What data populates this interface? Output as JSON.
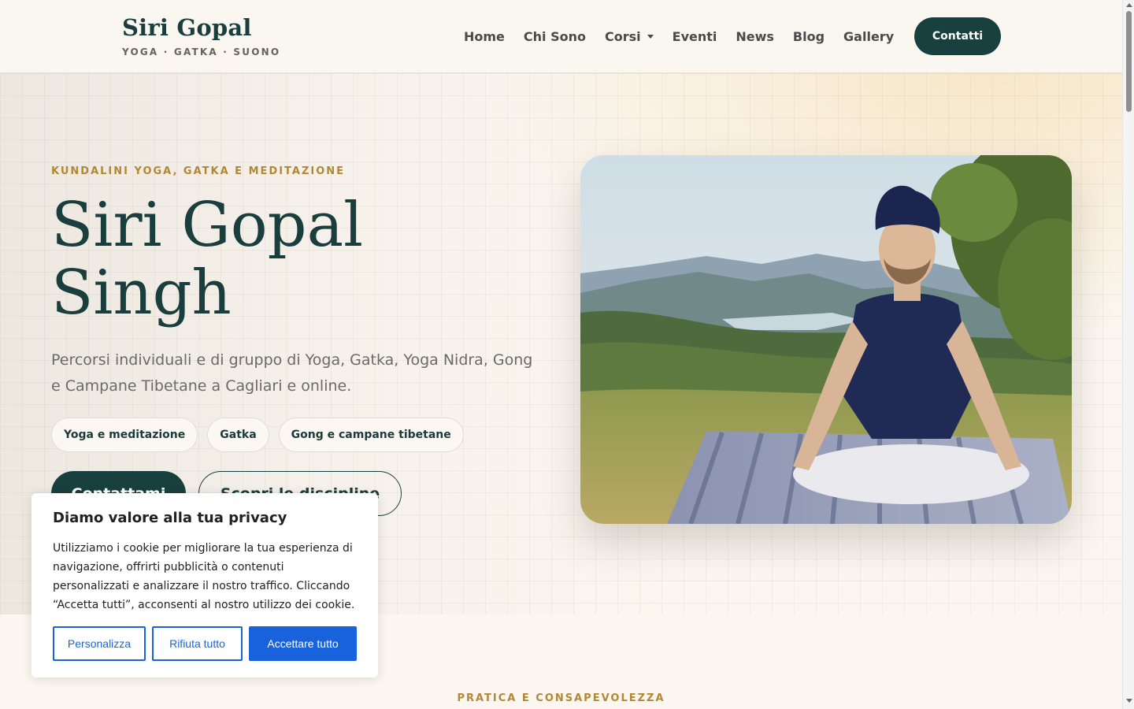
{
  "header": {
    "brand_title": "Siri Gopal",
    "brand_subtitle": "YOGA · GATKA · SUONO",
    "nav": [
      {
        "label": "Home"
      },
      {
        "label": "Chi Sono"
      },
      {
        "label": "Corsi",
        "has_dropdown": true
      },
      {
        "label": "Eventi"
      },
      {
        "label": "News"
      },
      {
        "label": "Blog"
      },
      {
        "label": "Gallery"
      }
    ],
    "cta_label": "Contatti"
  },
  "hero": {
    "eyebrow": "KUNDALINI YOGA, GATKA E MEDITAZIONE",
    "title_line1": "Siri Gopal",
    "title_line2": "Singh",
    "description": "Percorsi individuali e di gruppo di Yoga, Gatka, Yoga Nidra, Gong e Campane Tibetane a Cagliari e online.",
    "pills": [
      "Yoga e meditazione",
      "Gatka",
      "Gong e campane tibetane"
    ],
    "primary_button": "Contattami",
    "secondary_button": "Scopri le discipline",
    "image_icon": "meditating-man-photo"
  },
  "next_section": {
    "eyebrow": "PRATICA E CONSAPEVOLEZZA"
  },
  "cookie_banner": {
    "title": "Diamo valore alla tua privacy",
    "text": "Utilizziamo i cookie per migliorare la tua esperienza di navigazione, offrirti pubblicità o contenuti personalizzati e analizzare il nostro traffico. Cliccando “Accetta tutti”, acconsenti al nostro utilizzo dei cookie.",
    "customize_label": "Personalizza",
    "reject_label": "Rifiuta tutto",
    "accept_label": "Accettare tutto"
  },
  "colors": {
    "brand_dark": "#17403f",
    "accent_gold": "#b28735",
    "cookie_blue": "#1863dc"
  }
}
